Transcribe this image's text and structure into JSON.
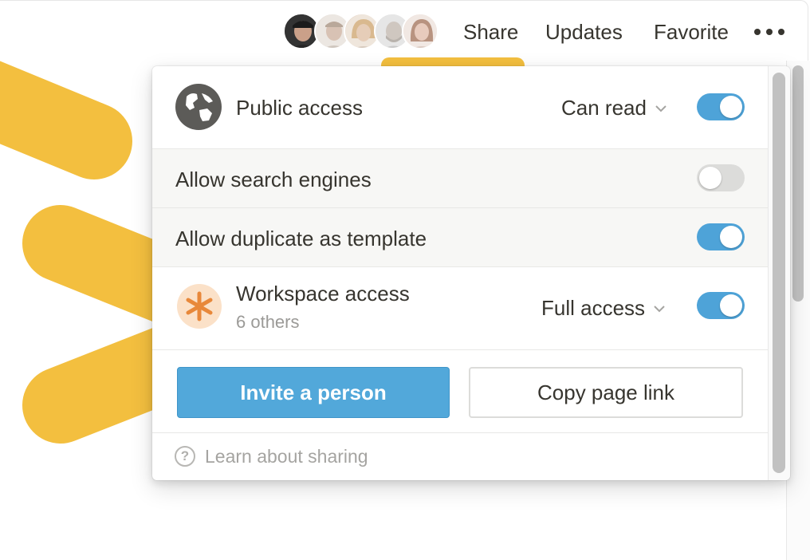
{
  "topbar": {
    "avatars": [
      {
        "name": "avatar-1"
      },
      {
        "name": "avatar-2"
      },
      {
        "name": "avatar-3"
      },
      {
        "name": "avatar-4"
      },
      {
        "name": "avatar-5"
      }
    ],
    "share_label": "Share",
    "updates_label": "Updates",
    "favorite_label": "Favorite",
    "more_icon": "more-horizontal-icon"
  },
  "share_menu": {
    "public_access": {
      "icon": "globe-icon",
      "label": "Public access",
      "permission": "Can read",
      "enabled": true
    },
    "search_engines": {
      "label": "Allow search engines",
      "enabled": false
    },
    "duplicate_template": {
      "label": "Allow duplicate as template",
      "enabled": true
    },
    "workspace_access": {
      "icon": "asterisk-icon",
      "label": "Workspace access",
      "sublabel": "6 others",
      "permission": "Full access",
      "enabled": true
    },
    "invite_button": "Invite a person",
    "copy_link_button": "Copy page link",
    "help_link": "Learn about sharing",
    "help_icon": "question-circle-icon"
  },
  "colors": {
    "accent_blue": "#52a8da",
    "toggle_on": "#4ea3d8",
    "toggle_off": "#dcdcda",
    "artwork_yellow": "#f3bf3f",
    "workspace_icon_bg": "#fbe1c8",
    "workspace_icon_fg": "#e8883a"
  }
}
